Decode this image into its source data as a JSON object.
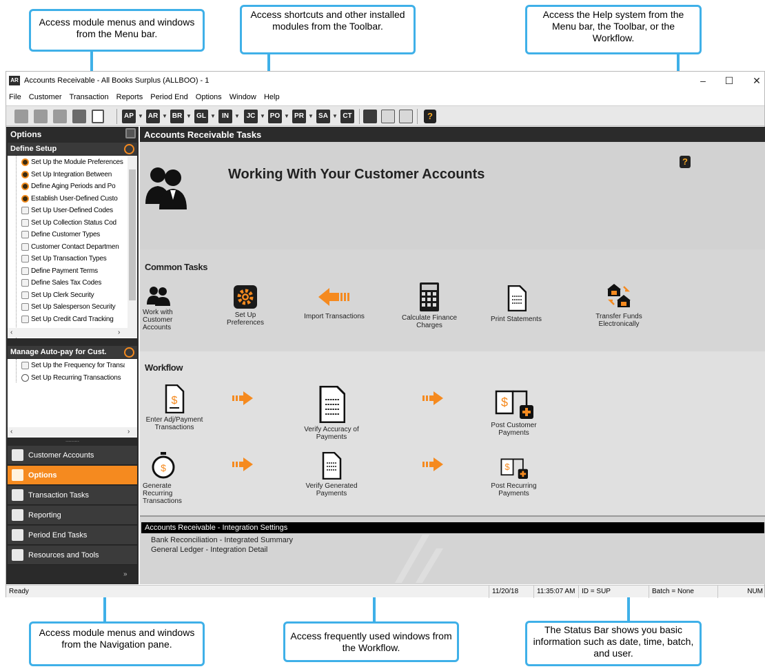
{
  "callouts": {
    "menu_bar": "Access module menus and windows from the Menu bar.",
    "toolbar": "Access shortcuts and other installed modules from the Toolbar.",
    "help": "Access the Help system from the Menu bar, the Toolbar, or the Workflow.",
    "navigation": "Access module menus and windows from the Navigation pane.",
    "workflow": "Access frequently used windows from the Workflow.",
    "status_bar": "The Status Bar shows you basic information such as date, time, batch, and user."
  },
  "window": {
    "app_icon": "AR",
    "title": "Accounts Receivable - All Books Surplus (ALLBOO) - 1",
    "minimize": "–",
    "maximize": "☐",
    "close": "✕"
  },
  "menu": [
    "File",
    "Customer",
    "Transaction",
    "Reports",
    "Period End",
    "Options",
    "Window",
    "Help"
  ],
  "toolbar": {
    "modules": [
      "AP",
      "AR",
      "BR",
      "GL",
      "IN",
      "JC",
      "PO",
      "PR",
      "SA",
      "CT"
    ],
    "help": "?"
  },
  "nav": {
    "header": "Options",
    "define_setup": {
      "title": "Define Setup",
      "items": [
        {
          "label": "Set Up the Module Preferences",
          "icon": "gear-icon"
        },
        {
          "label": "Set Up Integration Between",
          "icon": "gear-icon"
        },
        {
          "label": "Define Aging Periods and Po",
          "icon": "gear-icon"
        },
        {
          "label": "Establish User-Defined Custo",
          "icon": "gear-icon"
        },
        {
          "label": "Set Up User-Defined Codes",
          "icon": "document-icon"
        },
        {
          "label": "Set Up Collection Status Cod",
          "icon": "document-icon"
        },
        {
          "label": "Define Customer Types",
          "icon": "document-icon"
        },
        {
          "label": "Customer Contact Departmen",
          "icon": "document-icon"
        },
        {
          "label": "Set Up Transaction Types",
          "icon": "document-icon"
        },
        {
          "label": "Define Payment Terms",
          "icon": "document-icon"
        },
        {
          "label": "Define Sales Tax Codes",
          "icon": "document-icon"
        },
        {
          "label": "Set Up Clerk Security",
          "icon": "document-icon"
        },
        {
          "label": "Set Up Salesperson Security",
          "icon": "document-icon"
        },
        {
          "label": "Set Up Credit Card Tracking",
          "icon": "document-icon"
        }
      ]
    },
    "autopay": {
      "title": "Manage Auto-pay for Cust.",
      "items": [
        {
          "label": "Set Up the Frequency for Transa",
          "icon": "document-icon"
        },
        {
          "label": "Set Up Recurring Transactions",
          "icon": "clock-icon"
        }
      ]
    },
    "buttons": [
      "Customer Accounts",
      "Options",
      "Transaction Tasks",
      "Reporting",
      "Period End Tasks",
      "Resources and Tools"
    ],
    "active_button": "Options",
    "collapse_glyph": "»"
  },
  "main": {
    "header": "Accounts Receivable Tasks",
    "hero_title": "Working With Your Customer Accounts",
    "help_icon": "?",
    "common_tasks": {
      "title": "Common Tasks",
      "items": [
        "Work with Customer Accounts",
        "Set Up Preferences",
        "Import Transactions",
        "Calculate Finance Charges",
        "Print Statements",
        "Transfer Funds Electronically"
      ]
    },
    "workflow": {
      "title": "Workflow",
      "row1": [
        "Enter Adj/Payment Transactions",
        "Verify Accuracy of Payments",
        "Post Customer Payments"
      ],
      "row2": [
        "Generate Recurring Transactions",
        "Verify Generated Payments",
        "Post Recurring Payments"
      ]
    },
    "integration": {
      "title": "Accounts Receivable - Integration Settings",
      "links": [
        "Bank Reconciliation - Integrated Summary",
        "General Ledger - Integration Detail"
      ]
    }
  },
  "status": {
    "left": "Ready",
    "date": "11/20/18",
    "time": "11:35:07 AM",
    "id": "ID = SUP",
    "batch": "Batch = None",
    "num": "NUM"
  },
  "colors": {
    "callout_blue": "#3fb0e8",
    "accent_orange": "#f58a1f",
    "dark_header": "#2b2b2b"
  }
}
